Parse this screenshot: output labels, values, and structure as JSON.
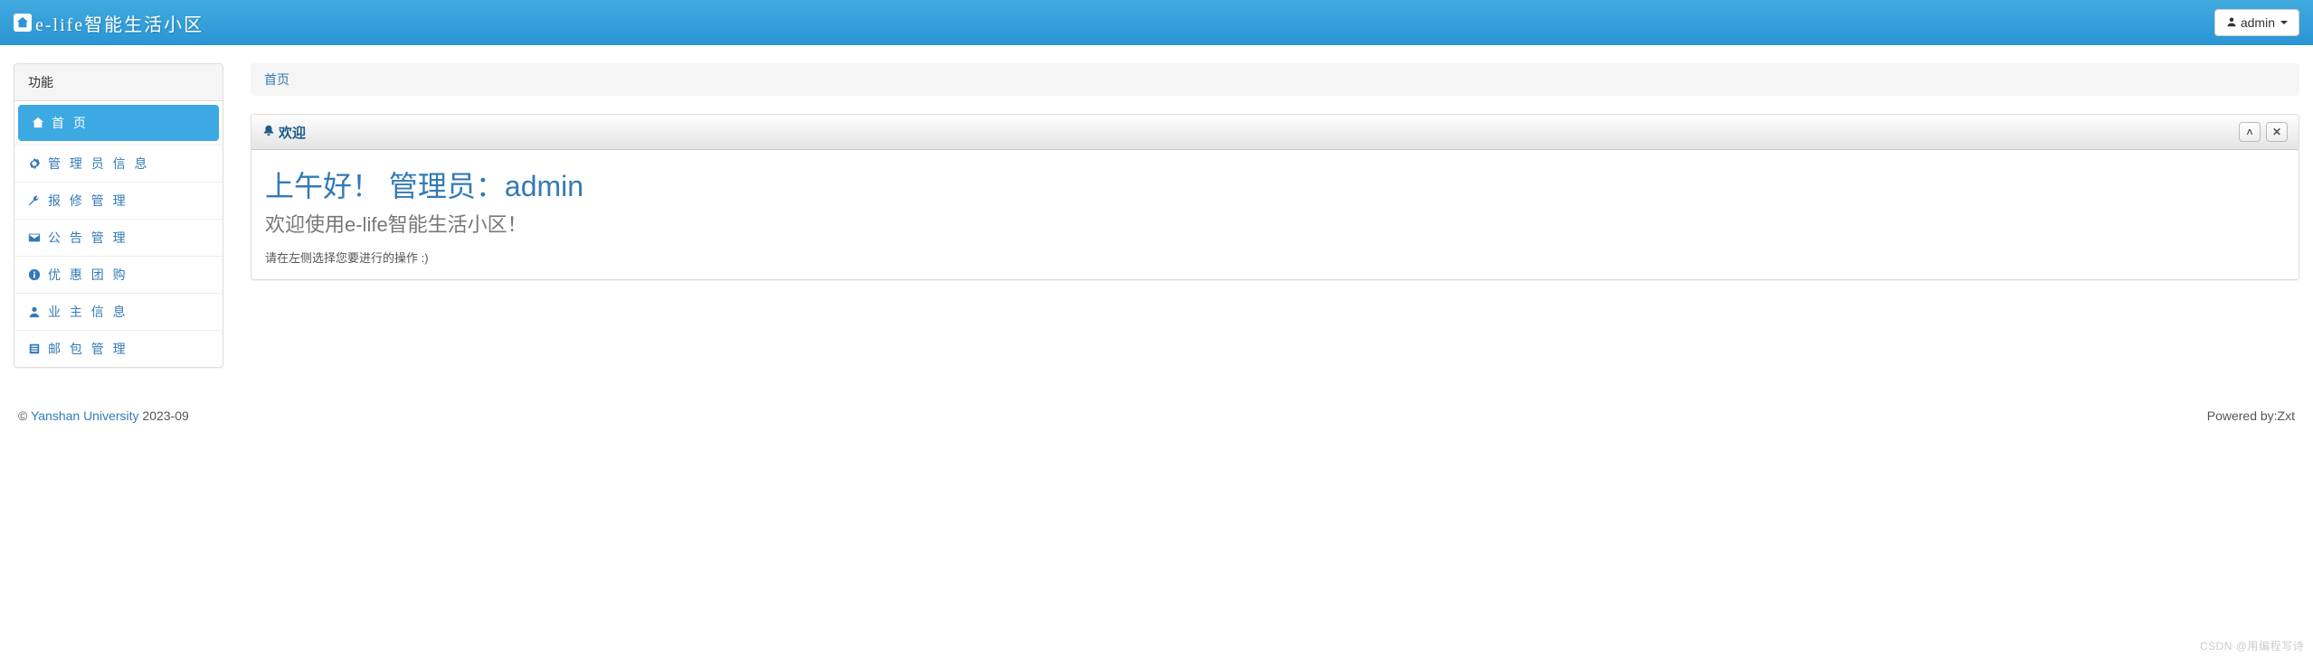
{
  "brand": "e-life智能生活小区",
  "user_label": "admin",
  "sidebar": {
    "heading": "功能",
    "items": [
      {
        "label": "首 页",
        "icon": "home-icon",
        "active": true
      },
      {
        "label": "管 理 员 信 息",
        "icon": "gear-icon",
        "active": false
      },
      {
        "label": "报 修 管 理",
        "icon": "wrench-icon",
        "active": false
      },
      {
        "label": "公 告 管 理",
        "icon": "envelope-icon",
        "active": false
      },
      {
        "label": "优 惠 团 购",
        "icon": "info-icon",
        "active": false
      },
      {
        "label": "业 主 信 息",
        "icon": "user-icon",
        "active": false
      },
      {
        "label": "邮 包 管 理",
        "icon": "list-icon",
        "active": false
      }
    ]
  },
  "breadcrumb": {
    "home": "首页"
  },
  "welcome": {
    "panel_title": "欢迎",
    "greeting": "上午好！  管理员：admin",
    "subtitle": "欢迎使用e-life智能生活小区！",
    "hint": "请在左侧选择您要进行的操作 :)"
  },
  "footer": {
    "copyright_prefix": "© ",
    "university": "Yanshan University",
    "year": " 2023-09",
    "powered": "Powered by:Zxt"
  },
  "watermark": "CSDN @用编程写诗"
}
